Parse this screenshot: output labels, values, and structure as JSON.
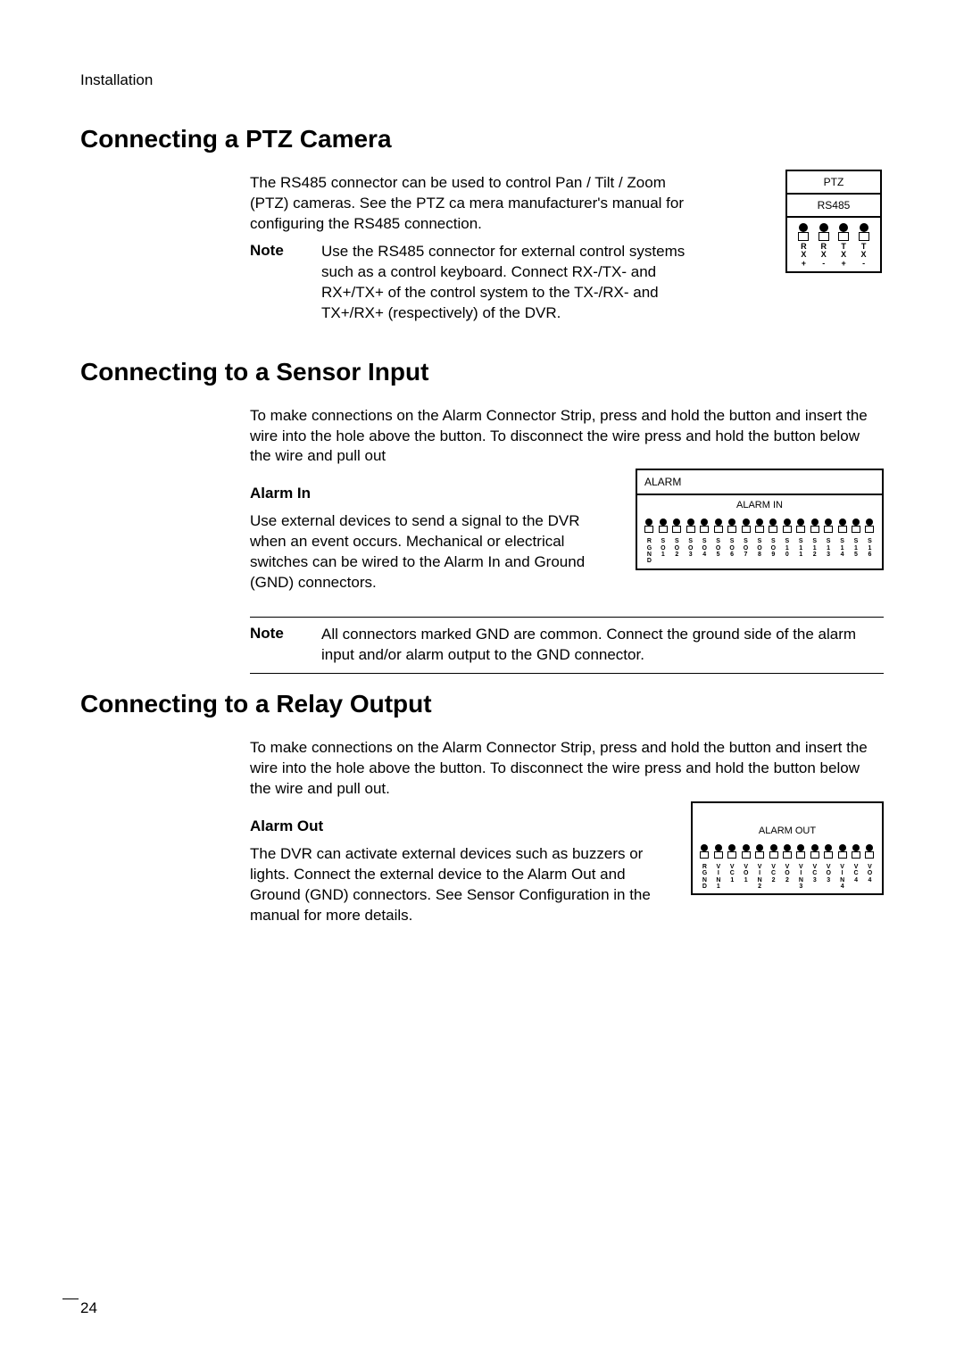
{
  "header_label": "Installation",
  "page_number": "24",
  "section_ptz": {
    "heading": "Connecting a PTZ Camera",
    "body": "The RS485 connector can be used to control Pan / Tilt / Zoom (PTZ) cameras. See the PTZ ca mera manufacturer's manual for configuring the RS485 connection.",
    "note_label": "Note",
    "note_text": "Use the RS485 connector for external control systems such as a control keyboard. Connect RX-/TX- and RX+/TX+ of the control system to the TX-/RX- and TX+/RX+ (respectively) of the DVR.",
    "fig": {
      "title": "PTZ",
      "subtitle": "RS485",
      "labels": [
        "RX\n+",
        "RX\n-",
        "TX\n+",
        "TX\n-"
      ]
    }
  },
  "section_sensor": {
    "heading": "Connecting to a Sensor Input",
    "body": "To make connections on the Alarm Connector Strip, press and hold the button and insert the wire into the hole above the button. To disconnect the wire press and hold the button below the wire and pull out",
    "subhead": "Alarm In",
    "subbody": "Use external devices to send a signal to the DVR when an event occurs. Mechanical or electrical switches can be wired to the Alarm In and Ground (GND) connectors.",
    "note_label": "Note",
    "note_text": "All connectors marked GND are common. Connect the ground side of the alarm input and/or alarm output to the GND connector.",
    "fig": {
      "title": "ALARM",
      "subtitle": "ALARM IN",
      "labels": [
        "RGND",
        "SO1",
        "SO2",
        "SO3",
        "SO4",
        "SO5",
        "SO6",
        "SO7",
        "SO8",
        "SO9",
        "S10",
        "S11",
        "S12",
        "S13",
        "S14",
        "S15",
        "S16"
      ]
    }
  },
  "section_relay": {
    "heading": "Connecting to a Relay Output",
    "body": "To make connections on the Alarm Connector Strip, press and hold the button and insert the wire into the hole above the button. To disconnect the wire press and hold the button below the wire and pull out.",
    "subhead": "Alarm Out",
    "subbody": "The DVR can activate external devices such as buzzers or lights. Connect the external device to the Alarm Out and Ground (GND) connectors. See Sensor Configuration in the manual for more details.",
    "fig": {
      "subtitle": "ALARM OUT",
      "labels": [
        "RGND",
        "VIN1",
        "VC1",
        "VO1",
        "VIN2",
        "VC2",
        "VO2",
        "VIN3",
        "VC3",
        "VO3",
        "VIN4",
        "VC4",
        "VO4"
      ]
    }
  }
}
